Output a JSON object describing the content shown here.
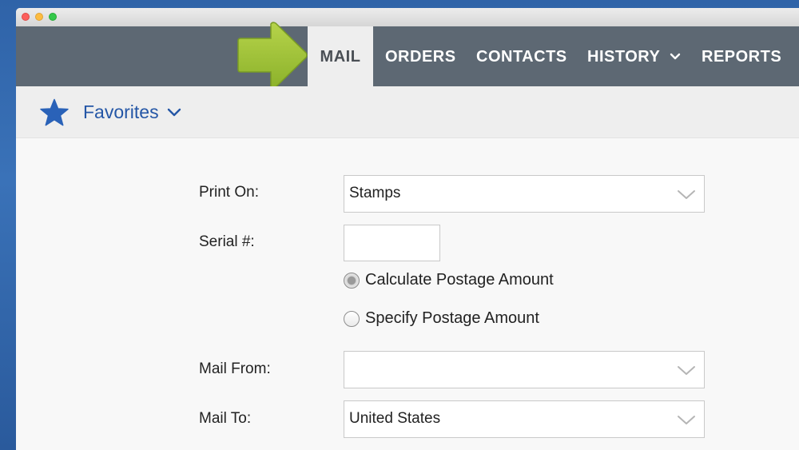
{
  "window": {
    "traffic_lights": [
      "close",
      "minimize",
      "zoom"
    ]
  },
  "nav": {
    "items": [
      {
        "label": "MAIL",
        "active": true
      },
      {
        "label": "ORDERS",
        "active": false
      },
      {
        "label": "CONTACTS",
        "active": false
      },
      {
        "label": "HISTORY",
        "active": false,
        "dropdown": true
      },
      {
        "label": "REPORTS",
        "active": false
      }
    ],
    "arrow_icon": "green-arrow-right-icon"
  },
  "favorites": {
    "label": "Favorites",
    "icon": "star-icon",
    "color": "#2456a6"
  },
  "form": {
    "print_on": {
      "label": "Print On:",
      "value": "Stamps"
    },
    "serial": {
      "label": "Serial #:",
      "value": ""
    },
    "postage_options": [
      {
        "label": "Calculate Postage Amount",
        "checked": true
      },
      {
        "label": "Specify Postage Amount",
        "checked": false
      }
    ],
    "mail_from": {
      "label": "Mail From:",
      "value": ""
    },
    "mail_to": {
      "label": "Mail To:",
      "value": "United States"
    }
  },
  "colors": {
    "nav_background": "#5d6873",
    "active_tab": "#eeeeee",
    "arrow": "#9cbf35",
    "desktop": "#2f63a8"
  }
}
